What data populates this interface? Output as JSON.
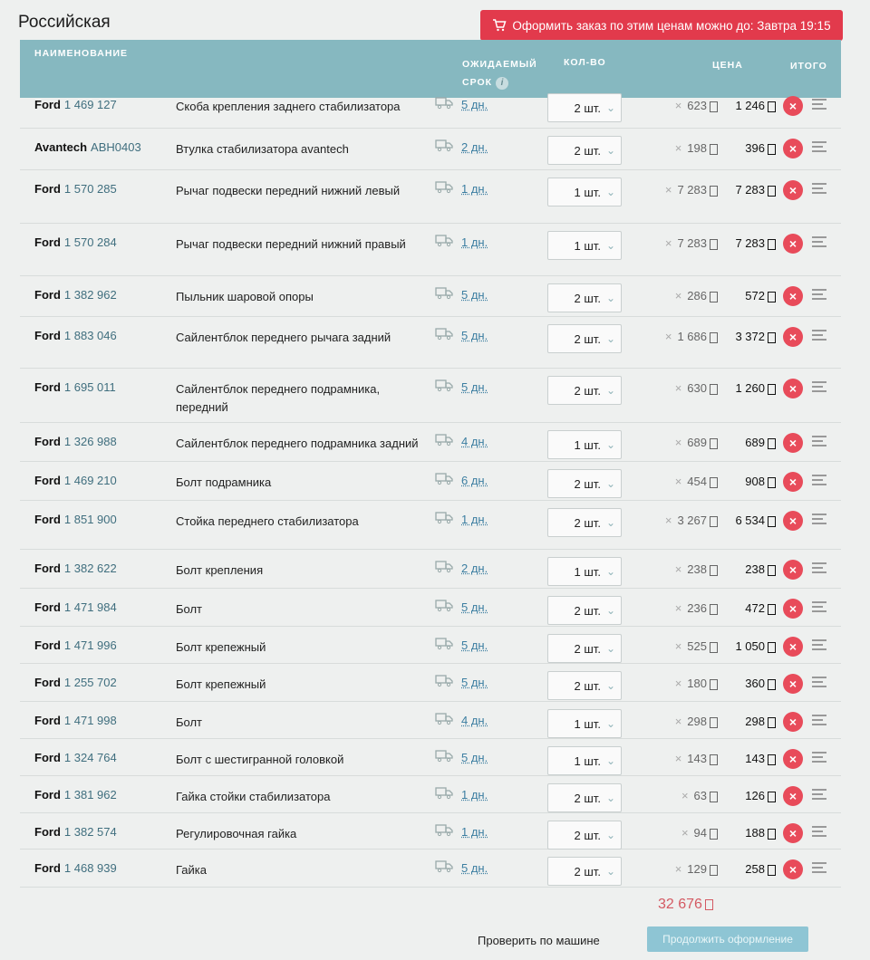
{
  "title": "Российская",
  "banner": {
    "text": "Оформить заказ по этим ценам можно до: Завтра 19:15",
    "icon": "cart-icon",
    "color": "#e23a4c"
  },
  "header": {
    "name": "НАИМЕНОВАНИЕ",
    "term_line1": "ОЖИДАЕМЫЙ",
    "term_line2": "СРОК",
    "info": "i",
    "qty": "КОЛ-ВО",
    "price": "ЦЕНА",
    "total": "ИТОГО"
  },
  "rows": [
    {
      "brand": "Ford",
      "num": "1 469 127",
      "desc": "Скоба крепления заднего стабилизатора",
      "term": "5 дн.",
      "qty": "2 шт.",
      "price": "623",
      "total": "1 246"
    },
    {
      "brand": "Avantech",
      "num": "ABH0403",
      "desc": "Втулка стабилизатора avantech",
      "term": "2 дн.",
      "qty": "2 шт.",
      "price": "198",
      "total": "396"
    },
    {
      "brand": "Ford",
      "num": "1 570 285",
      "desc": "Рычаг подвески передний нижний левый",
      "term": "1 дн.",
      "qty": "1 шт.",
      "price": "7 283",
      "total": "7 283"
    },
    {
      "brand": "Ford",
      "num": "1 570 284",
      "desc": "Рычаг подвески передний нижний правый",
      "term": "1 дн.",
      "qty": "1 шт.",
      "price": "7 283",
      "total": "7 283"
    },
    {
      "brand": "Ford",
      "num": "1 382 962",
      "desc": "Пыльник шаровой опоры",
      "term": "5 дн.",
      "qty": "2 шт.",
      "price": "286",
      "total": "572"
    },
    {
      "brand": "Ford",
      "num": "1 883 046",
      "desc": "Сайлентблок переднего рычага задний",
      "term": "5 дн.",
      "qty": "2 шт.",
      "price": "1 686",
      "total": "3 372"
    },
    {
      "brand": "Ford",
      "num": "1 695 011",
      "desc": "Сайлентблок переднего подрамника, передний",
      "term": "5 дн.",
      "qty": "2 шт.",
      "price": "630",
      "total": "1 260"
    },
    {
      "brand": "Ford",
      "num": "1 326 988",
      "desc": "Сайлентблок переднего подрамника задний",
      "term": "4 дн.",
      "qty": "1 шт.",
      "price": "689",
      "total": "689"
    },
    {
      "brand": "Ford",
      "num": "1 469 210",
      "desc": "Болт подрамника",
      "term": "6 дн.",
      "qty": "2 шт.",
      "price": "454",
      "total": "908"
    },
    {
      "brand": "Ford",
      "num": "1 851 900",
      "desc": "Стойка переднего стабилизатора",
      "term": "1 дн.",
      "qty": "2 шт.",
      "price": "3 267",
      "total": "6 534"
    },
    {
      "brand": "Ford",
      "num": "1 382 622",
      "desc": "Болт крепления",
      "term": "2 дн.",
      "qty": "1 шт.",
      "price": "238",
      "total": "238"
    },
    {
      "brand": "Ford",
      "num": "1 471 984",
      "desc": "Болт",
      "term": "5 дн.",
      "qty": "2 шт.",
      "price": "236",
      "total": "472"
    },
    {
      "brand": "Ford",
      "num": "1 471 996",
      "desc": "Болт крепежный",
      "term": "5 дн.",
      "qty": "2 шт.",
      "price": "525",
      "total": "1 050"
    },
    {
      "brand": "Ford",
      "num": "1 255 702",
      "desc": "Болт крепежный",
      "term": "5 дн.",
      "qty": "2 шт.",
      "price": "180",
      "total": "360"
    },
    {
      "brand": "Ford",
      "num": "1 471 998",
      "desc": "Болт",
      "term": "4 дн.",
      "qty": "1 шт.",
      "price": "298",
      "total": "298"
    },
    {
      "brand": "Ford",
      "num": "1 324 764",
      "desc": "Болт с шестигранной головкой",
      "term": "5 дн.",
      "qty": "1 шт.",
      "price": "143",
      "total": "143"
    },
    {
      "brand": "Ford",
      "num": "1 381 962",
      "desc": "Гайка стойки стабилизатора",
      "term": "1 дн.",
      "qty": "2 шт.",
      "price": "63",
      "total": "126"
    },
    {
      "brand": "Ford",
      "num": "1 382 574",
      "desc": "Регулировочная гайка",
      "term": "1 дн.",
      "qty": "2 шт.",
      "price": "94",
      "total": "188"
    },
    {
      "brand": "Ford",
      "num": "1 468 939",
      "desc": "Гайка",
      "term": "5 дн.",
      "qty": "2 шт.",
      "price": "129",
      "total": "258"
    }
  ],
  "grand_total": "32 676",
  "check_link": "Проверить по машине",
  "continue_button": "Продолжить оформление",
  "currency_symbol": "₽"
}
